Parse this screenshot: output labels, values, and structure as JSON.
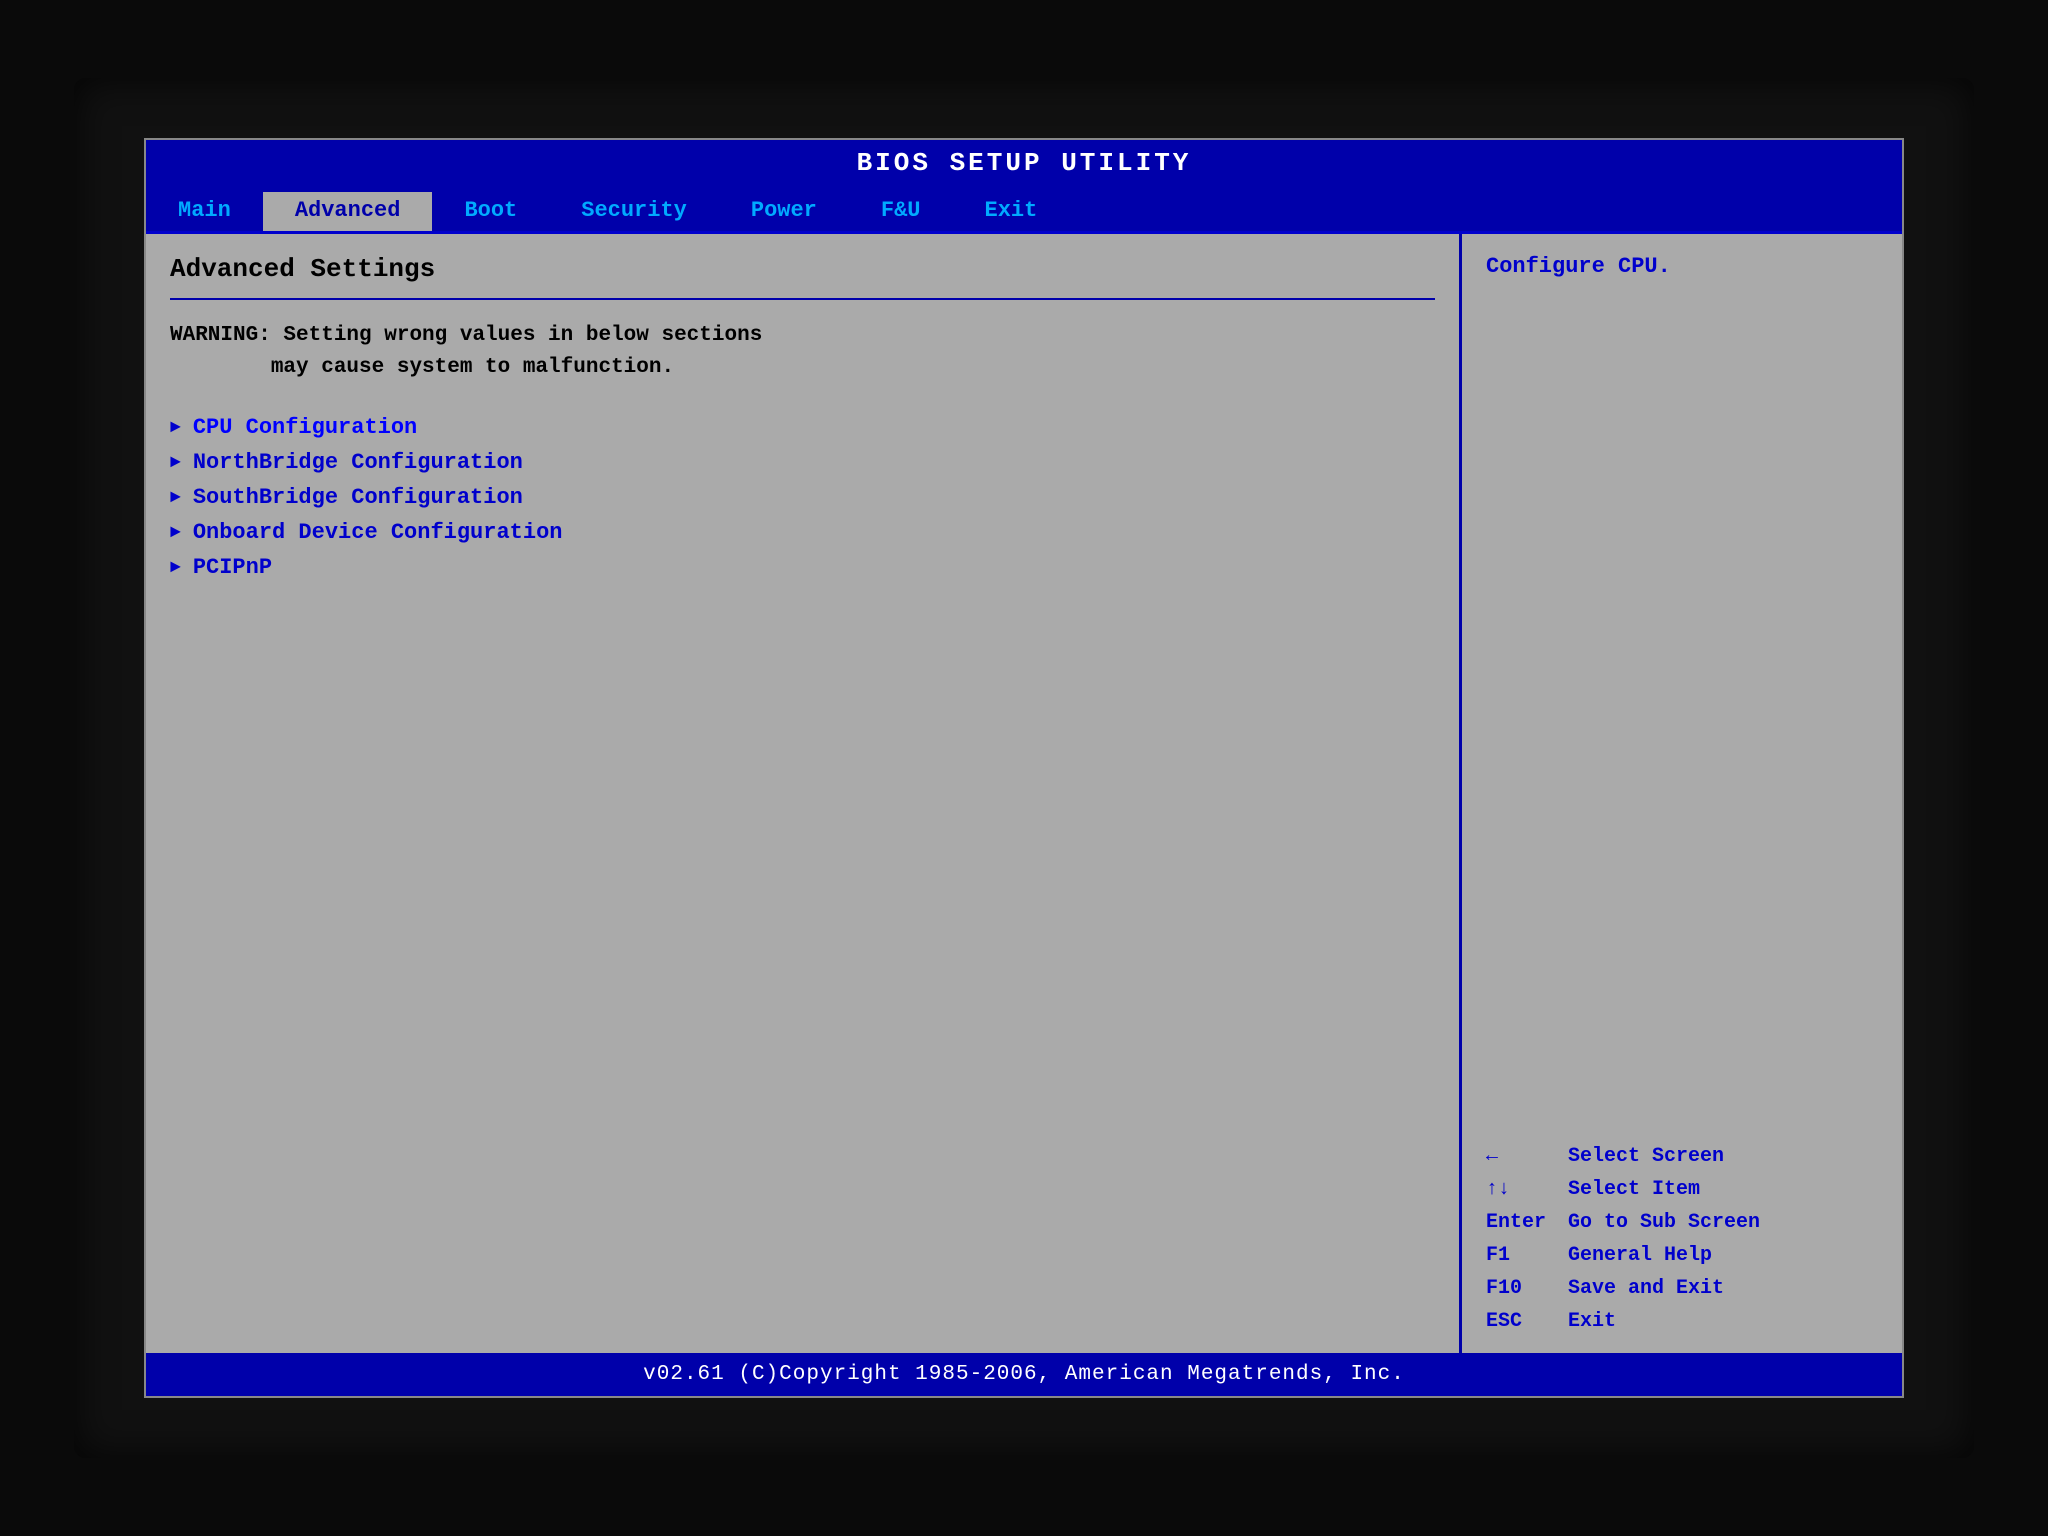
{
  "title_bar": {
    "text": "BIOS SETUP UTILITY"
  },
  "nav": {
    "items": [
      {
        "label": "Main",
        "active": false
      },
      {
        "label": "Advanced",
        "active": true
      },
      {
        "label": "Boot",
        "active": false
      },
      {
        "label": "Security",
        "active": false
      },
      {
        "label": "Power",
        "active": false
      },
      {
        "label": "F&U",
        "active": false
      },
      {
        "label": "Exit",
        "active": false
      }
    ]
  },
  "left_panel": {
    "title": "Advanced Settings",
    "warning": "WARNING: Setting wrong values in below sections\n        may cause system to malfunction.",
    "menu_items": [
      {
        "label": "CPU Configuration"
      },
      {
        "label": "NorthBridge Configuration"
      },
      {
        "label": "SouthBridge Configuration"
      },
      {
        "label": "Onboard Device Configuration"
      },
      {
        "label": "PCIPnP"
      }
    ]
  },
  "right_panel": {
    "help_text": "Configure CPU.",
    "key_guide": [
      {
        "key": "←",
        "desc": "Select Screen"
      },
      {
        "key": "↑↓",
        "desc": "Select Item"
      },
      {
        "key": "Enter",
        "desc": "Go to Sub Screen"
      },
      {
        "key": "F1",
        "desc": "General Help"
      },
      {
        "key": "F10",
        "desc": "Save and Exit"
      },
      {
        "key": "ESC",
        "desc": "Exit"
      }
    ]
  },
  "footer": {
    "text": "v02.61 (C)Copyright 1985-2006, American Megatrends, Inc."
  }
}
